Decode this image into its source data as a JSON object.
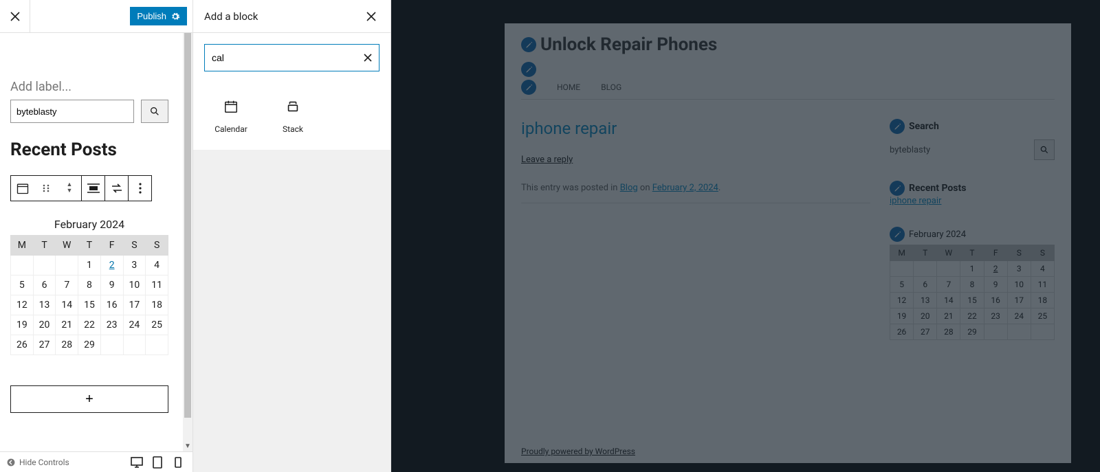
{
  "editor": {
    "publish_label": "Publish",
    "add_label_placeholder": "Add label...",
    "search_value": "byteblasty",
    "recent_posts_heading": "Recent Posts",
    "calendar": {
      "title": "February 2024",
      "days": [
        "M",
        "T",
        "W",
        "T",
        "F",
        "S",
        "S"
      ],
      "weeks": [
        [
          "",
          "",
          "",
          "1",
          "2",
          "3",
          "4"
        ],
        [
          "5",
          "6",
          "7",
          "8",
          "9",
          "10",
          "11"
        ],
        [
          "12",
          "13",
          "14",
          "15",
          "16",
          "17",
          "18"
        ],
        [
          "19",
          "20",
          "21",
          "22",
          "23",
          "24",
          "25"
        ],
        [
          "26",
          "27",
          "28",
          "29",
          "",
          "",
          ""
        ]
      ],
      "linked_day": "2"
    },
    "add_block_plus": "+",
    "footer": {
      "hide_controls": "Hide Controls"
    }
  },
  "inserter": {
    "title": "Add a block",
    "search_value": "cal",
    "results": [
      {
        "label": "Calendar",
        "icon": "calendar"
      },
      {
        "label": "Stack",
        "icon": "stack"
      }
    ]
  },
  "preview": {
    "site_title": "Unlock Repair Phones",
    "nav": [
      "HOME",
      "BLOG"
    ],
    "post": {
      "title": "iphone repair",
      "leave_reply": "Leave a reply",
      "meta_prefix": "This entry was posted in ",
      "meta_cat": "Blog",
      "meta_mid": " on ",
      "meta_date": "February 2, 2024",
      "meta_suffix": "."
    },
    "sidebar": {
      "search_title": "Search",
      "search_text": "byteblasty",
      "recent_title": "Recent Posts",
      "recent_link": "iphone repair",
      "cal_title": "February 2024",
      "cal_days": [
        "M",
        "T",
        "W",
        "T",
        "F",
        "S",
        "S"
      ],
      "cal_weeks": [
        [
          "",
          "",
          "",
          "1",
          "2",
          "3",
          "4"
        ],
        [
          "5",
          "6",
          "7",
          "8",
          "9",
          "10",
          "11"
        ],
        [
          "12",
          "13",
          "14",
          "15",
          "16",
          "17",
          "18"
        ],
        [
          "19",
          "20",
          "21",
          "22",
          "23",
          "24",
          "25"
        ],
        [
          "26",
          "27",
          "28",
          "29",
          "",
          "",
          ""
        ]
      ],
      "cal_linked_day": "2"
    },
    "footer": "Proudly powered by WordPress"
  }
}
